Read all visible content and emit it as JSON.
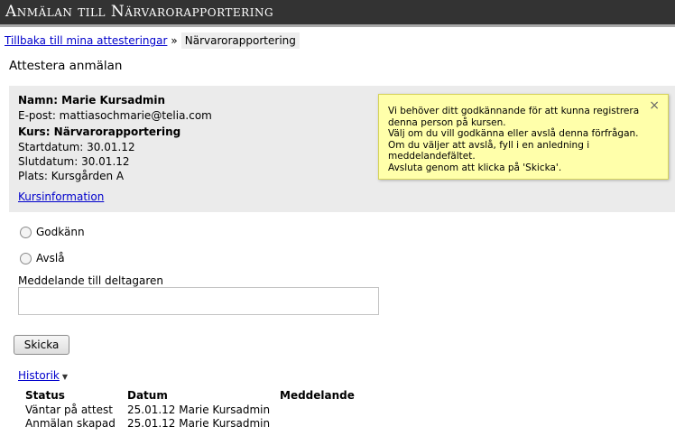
{
  "header": {
    "title": "Anmälan till Närvarorapportering"
  },
  "breadcrumb": {
    "back_link": "Tillbaka till mina attesteringar",
    "separator": "»",
    "current": "Närvarorapportering"
  },
  "page": {
    "title": "Attestera anmälan"
  },
  "person": {
    "name_line": "Namn: Marie Kursadmin",
    "email_line": "E-post: mattiasochmarie@telia.com",
    "course_line": "Kurs: Närvarorapportering",
    "start_line": "Startdatum: 30.01.12",
    "end_line": "Slutdatum: 30.01.12",
    "place_line": "Plats: Kursgården A",
    "course_info_link": "Kursinformation"
  },
  "tooltip": {
    "text": "Vi behöver ditt godkännande för att kunna registrera\ndenna person på kursen.\nVälj om du vill godkänna eller avslå denna förfrågan.\nOm du väljer att avslå, fyll i en anledning i\nmeddelandefältet.\nAvsluta genom att klicka på 'Skicka'.",
    "close_symbol": "×"
  },
  "decision": {
    "approve_label": "Godkänn",
    "reject_label": "Avslå",
    "message_label": "Meddelande till deltagaren",
    "message_value": ""
  },
  "actions": {
    "send_label": "Skicka"
  },
  "history": {
    "link_label": "Historik",
    "caret": "▼",
    "headers": {
      "status": "Status",
      "date": "Datum",
      "message": "Meddelande"
    },
    "rows": [
      {
        "status": "Väntar på attest",
        "date": "25.01.12 Marie Kursadmin",
        "message": ""
      },
      {
        "status": "Anmälan skapad",
        "date": "25.01.12 Marie Kursadmin",
        "message": ""
      }
    ]
  }
}
